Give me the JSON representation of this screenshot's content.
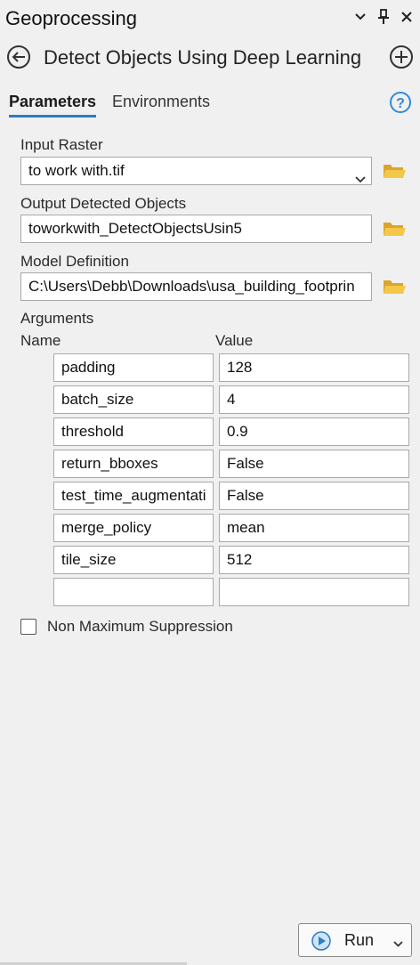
{
  "pane": {
    "title": "Geoprocessing",
    "icons": [
      "chevron-down-icon",
      "pin-icon",
      "close-icon"
    ]
  },
  "tool": {
    "title": "Detect Objects Using Deep Learning"
  },
  "tabs": [
    {
      "label": "Parameters",
      "active": true
    },
    {
      "label": "Environments",
      "active": false
    }
  ],
  "fields": {
    "input_raster": {
      "label": "Input Raster",
      "value": "to work with.tif"
    },
    "output_objects": {
      "label": "Output Detected Objects",
      "value": "toworkwith_DetectObjectsUsin5"
    },
    "model_definition": {
      "label": "Model Definition",
      "value": "C:\\Users\\Debb\\Downloads\\usa_building_footprin"
    }
  },
  "arguments": {
    "label": "Arguments",
    "col_name": "Name",
    "col_value": "Value",
    "rows": [
      {
        "name": "padding",
        "value": "128"
      },
      {
        "name": "batch_size",
        "value": "4"
      },
      {
        "name": "threshold",
        "value": "0.9"
      },
      {
        "name": "return_bboxes",
        "value": "False"
      },
      {
        "name": "test_time_augmentati",
        "value": "False"
      },
      {
        "name": "merge_policy",
        "value": "mean"
      },
      {
        "name": "tile_size",
        "value": "512"
      },
      {
        "name": "",
        "value": ""
      }
    ]
  },
  "nms": {
    "label": "Non Maximum Suppression",
    "checked": false
  },
  "run": {
    "label": "Run"
  },
  "colors": {
    "accent": "#2d7cc1",
    "folder": "#e8b83c",
    "help": "#2f8ad8"
  }
}
